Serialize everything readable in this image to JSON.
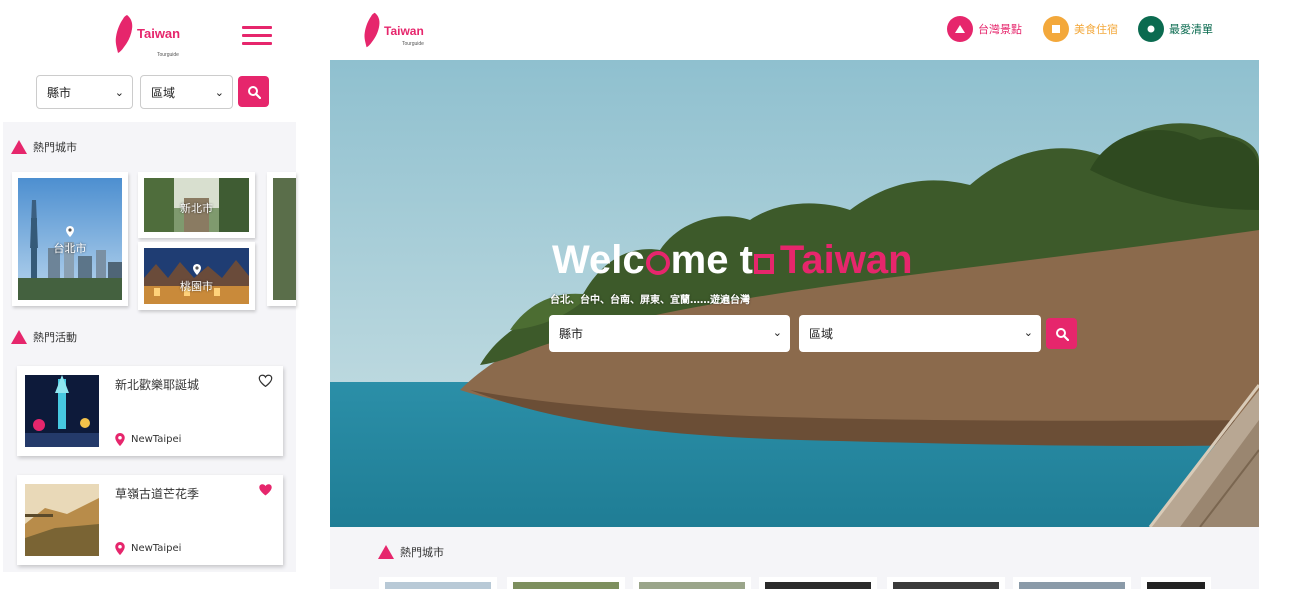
{
  "brand": {
    "name": "Taiwan",
    "tagline": "Tourguide",
    "accent": "#e6266c"
  },
  "mobile": {
    "filters": {
      "county_label": "縣市",
      "area_label": "區域"
    },
    "popular_cities": {
      "title": "熱門城市",
      "items": [
        {
          "label": "台北市"
        },
        {
          "label": "新北市"
        },
        {
          "label": "桃園市"
        }
      ]
    },
    "popular_events": {
      "title": "熱門活動",
      "items": [
        {
          "title": "新北歡樂耶誕城",
          "location": "NewTaipei",
          "favorited": false
        },
        {
          "title": "草嶺古道芒花季",
          "location": "NewTaipei",
          "favorited": true
        }
      ]
    }
  },
  "desktop": {
    "nav": [
      {
        "label": "台灣景點",
        "icon": "triangle-icon",
        "color": "#e6266c"
      },
      {
        "label": "美食住宿",
        "icon": "square-icon",
        "color": "#f3a83b"
      },
      {
        "label": "最愛清單",
        "icon": "circle-icon",
        "color": "#0b6b50"
      }
    ],
    "hero": {
      "title_part1": "Welc",
      "title_part2": "me t",
      "title_part3": "Taiwan",
      "subtitle": "台北、台中、台南、屏東、宜蘭……遊遍台灣",
      "county_label": "縣市",
      "area_label": "區域"
    },
    "popular_cities_title": "熱門城市"
  }
}
